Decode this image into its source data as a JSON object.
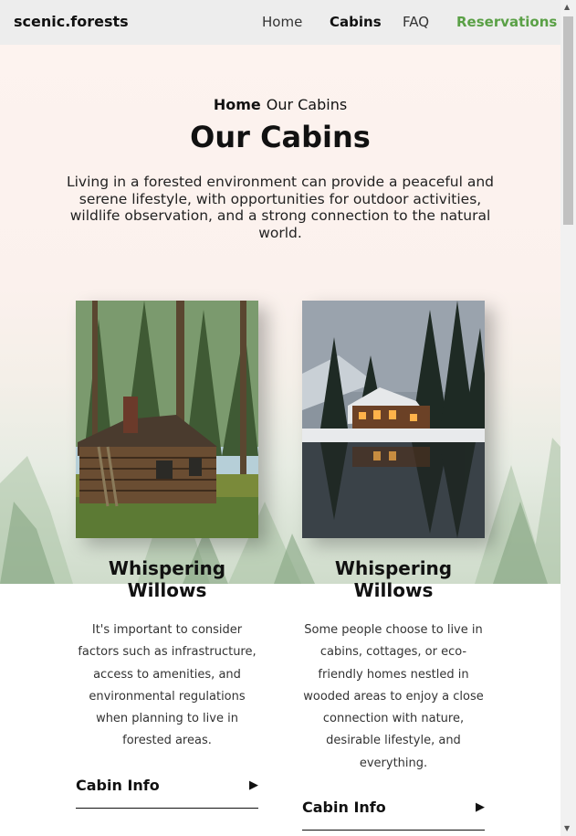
{
  "header": {
    "brand": "scenic.forests",
    "nav": [
      "Home",
      "Cabins",
      "FAQ",
      "Reservations"
    ]
  },
  "hero": {
    "breadcrumb_home": "Home",
    "breadcrumb_current": "Our Cabins",
    "title": "Our Cabins",
    "intro": "Living in a forested environment can provide a peaceful and serene lifestyle, with opportunities for outdoor activities, wildlife observation, and a strong connection to the natural world."
  },
  "cards": [
    {
      "title": "Whispering Willows",
      "text": "It's important to consider factors such as infrastructure, access to amenities, and environmental regulations when planning to live in forested areas.",
      "link": "Cabin Info"
    },
    {
      "title": "Whispering Willows",
      "text": "Some people choose to live in cabins, cottages, or eco-friendly homes nestled in wooded areas to enjoy a close connection with nature, desirable lifestyle, and everything.",
      "link": "Cabin Info"
    }
  ],
  "colors": {
    "accent": "#5aa046",
    "topbar": "#ededed"
  }
}
